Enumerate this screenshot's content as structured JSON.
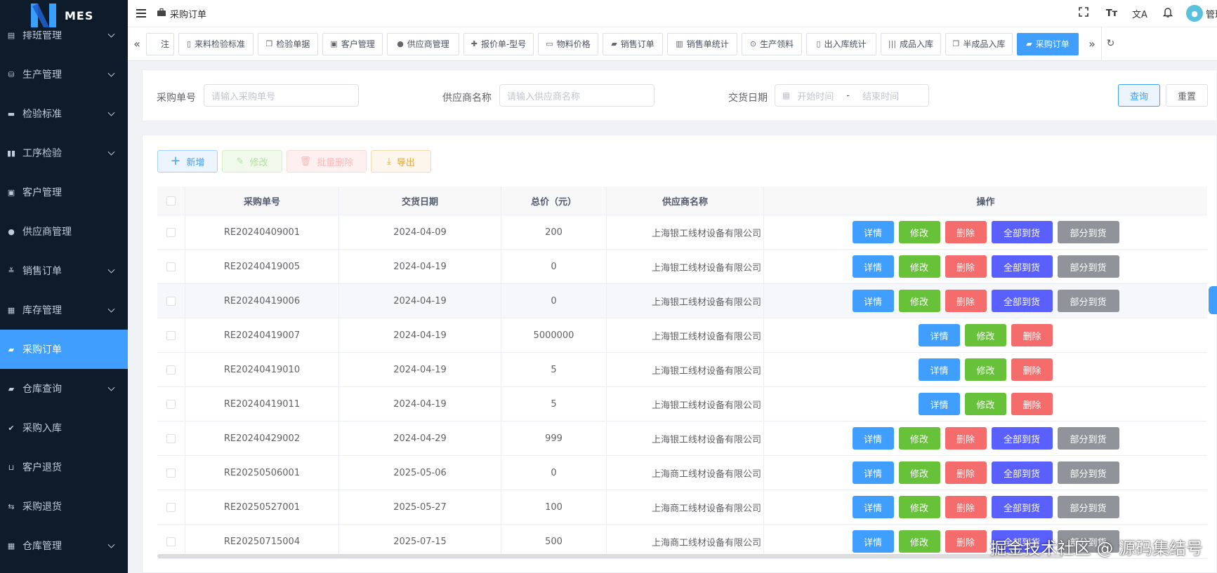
{
  "app": {
    "name": "MES"
  },
  "topbar": {
    "crumb": "采购订单",
    "user": "管理"
  },
  "sidebar": {
    "items": [
      {
        "label": "排班管理",
        "icon": "calendar-icon",
        "arrow": true
      },
      {
        "label": "生产管理",
        "icon": "database-icon",
        "arrow": true
      },
      {
        "label": "检验标准",
        "icon": "monitor-icon",
        "arrow": true
      },
      {
        "label": "工序检验",
        "icon": "book-icon",
        "arrow": true
      },
      {
        "label": "客户管理",
        "icon": "contact-icon",
        "arrow": false
      },
      {
        "label": "供应商管理",
        "icon": "user-icon",
        "arrow": false
      },
      {
        "label": "销售订单",
        "icon": "chart-icon",
        "arrow": true
      },
      {
        "label": "库存管理",
        "icon": "package-icon",
        "arrow": true
      },
      {
        "label": "采购订单",
        "icon": "briefcase-icon",
        "arrow": false,
        "active": true
      },
      {
        "label": "仓库查询",
        "icon": "briefcase-icon",
        "arrow": true
      },
      {
        "label": "采购入库",
        "icon": "check-icon",
        "arrow": false
      },
      {
        "label": "客户退货",
        "icon": "inbox-icon",
        "arrow": false
      },
      {
        "label": "采购退货",
        "icon": "return-icon",
        "arrow": false
      },
      {
        "label": "仓库管理",
        "icon": "package-icon",
        "arrow": true
      }
    ]
  },
  "tags": [
    {
      "label": "注",
      "icon": ""
    },
    {
      "label": "来料检验标准",
      "icon": "clipboard-icon"
    },
    {
      "label": "检验单据",
      "icon": "copy-icon"
    },
    {
      "label": "客户管理",
      "icon": "contact-icon"
    },
    {
      "label": "供应商管理",
      "icon": "user-icon"
    },
    {
      "label": "报价单-型号",
      "icon": "pin-icon"
    },
    {
      "label": "物料价格",
      "icon": "money-icon"
    },
    {
      "label": "销售订单",
      "icon": "shop-icon"
    },
    {
      "label": "销售单统计",
      "icon": "stats-icon"
    },
    {
      "label": "生产领料",
      "icon": "location-icon"
    },
    {
      "label": "出入库统计",
      "icon": "document-icon"
    },
    {
      "label": "成品入库",
      "icon": "barcode-icon"
    },
    {
      "label": "半成品入库",
      "icon": "copy-icon"
    },
    {
      "label": "采购订单",
      "icon": "briefcase-icon",
      "active": true
    }
  ],
  "search": {
    "order_no_label": "采购单号",
    "order_no_placeholder": "请输入采购单号",
    "supplier_label": "供应商名称",
    "supplier_placeholder": "请输入供应商名称",
    "date_label": "交货日期",
    "date_start": "开始时间",
    "date_sep": "-",
    "date_end": "结束时间",
    "query_button": "查询",
    "reset_button": "重置"
  },
  "toolbar": {
    "add": "新增",
    "edit": "修改",
    "batch_delete": "批量删除",
    "export": "导出"
  },
  "table": {
    "headers": {
      "order_no": "采购单号",
      "delivery_date": "交货日期",
      "total": "总价（元）",
      "supplier": "供应商名称",
      "actions": "操作"
    },
    "action_labels": {
      "detail": "详情",
      "edit": "修改",
      "delete": "删除",
      "full": "全部到货",
      "partial": "部分到货"
    },
    "rows": [
      {
        "order_no": "RE20240409001",
        "date": "2024-04-09",
        "total": "200",
        "supplier": "上海银工线材设备有限公司",
        "arrival": true
      },
      {
        "order_no": "RE20240419005",
        "date": "2024-04-19",
        "total": "0",
        "supplier": "上海银工线材设备有限公司",
        "arrival": true
      },
      {
        "order_no": "RE20240419006",
        "date": "2024-04-19",
        "total": "0",
        "supplier": "上海银工线材设备有限公司",
        "arrival": true
      },
      {
        "order_no": "RE20240419007",
        "date": "2024-04-19",
        "total": "5000000",
        "supplier": "上海银工线材设备有限公司",
        "arrival": false
      },
      {
        "order_no": "RE20240419010",
        "date": "2024-04-19",
        "total": "5",
        "supplier": "上海银工线材设备有限公司",
        "arrival": false
      },
      {
        "order_no": "RE20240419011",
        "date": "2024-04-19",
        "total": "5",
        "supplier": "上海银工线材设备有限公司",
        "arrival": false
      },
      {
        "order_no": "RE20240429002",
        "date": "2024-04-29",
        "total": "999",
        "supplier": "上海银工线材设备有限公司",
        "arrival": true
      },
      {
        "order_no": "RE20250506001",
        "date": "2025-05-06",
        "total": "0",
        "supplier": "上海商工线材设备有限公司",
        "arrival": true
      },
      {
        "order_no": "RE20250527001",
        "date": "2025-05-27",
        "total": "100",
        "supplier": "上海商工线材设备有限公司",
        "arrival": true
      },
      {
        "order_no": "RE20250715004",
        "date": "2025-07-15",
        "total": "500",
        "supplier": "上海商工线材设备有限公司",
        "arrival": true
      }
    ]
  },
  "watermark": "掘金技术社区 @ 源码集结号",
  "colors": {
    "sidebar_bg": "#0d1b2a",
    "primary": "#409eff",
    "success": "#67c23a",
    "danger": "#f56c6c",
    "arrival": "#5a5fff",
    "info": "#909399"
  }
}
